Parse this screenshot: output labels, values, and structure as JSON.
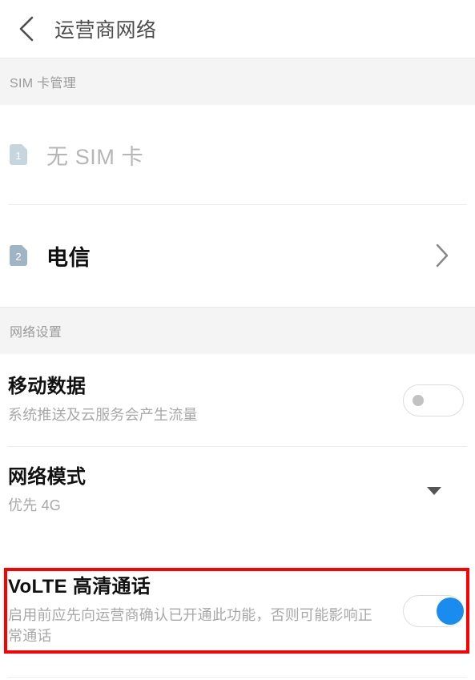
{
  "appbar": {
    "back_icon": "chevron-left-icon",
    "title": "运营商网络"
  },
  "sections": {
    "sim": {
      "header": "SIM 卡管理",
      "rows": [
        {
          "badge": "1",
          "label": "无 SIM 卡",
          "state": "disabled",
          "chevron": false
        },
        {
          "badge": "2",
          "label": "电信",
          "state": "active",
          "chevron": true,
          "chevron_icon": "chevron-right-icon"
        }
      ]
    },
    "network": {
      "header": "网络设置",
      "rows": [
        {
          "title": "移动数据",
          "subtitle": "系统推送及云服务会产生流量",
          "control": "toggle",
          "toggle_state": "off"
        },
        {
          "title": "网络模式",
          "subtitle": "优先 4G",
          "control": "dropdown",
          "dropdown_icon": "caret-down-icon"
        },
        {
          "title": "VoLTE 高清通话",
          "subtitle": "启用前应先向运营商确认已开通此功能，否则可能影响正常通话",
          "control": "toggle",
          "toggle_state": "on",
          "highlighted": true
        }
      ]
    }
  },
  "colors": {
    "accent_on": "#1a8cf0",
    "highlight_border": "#fe0000",
    "badge_disabled": "#c7d5de",
    "badge_active": "#9fb4c4",
    "section_bg": "#f4f4f4",
    "title_text": "#111111",
    "subtitle_text": "#a8a8a8"
  }
}
